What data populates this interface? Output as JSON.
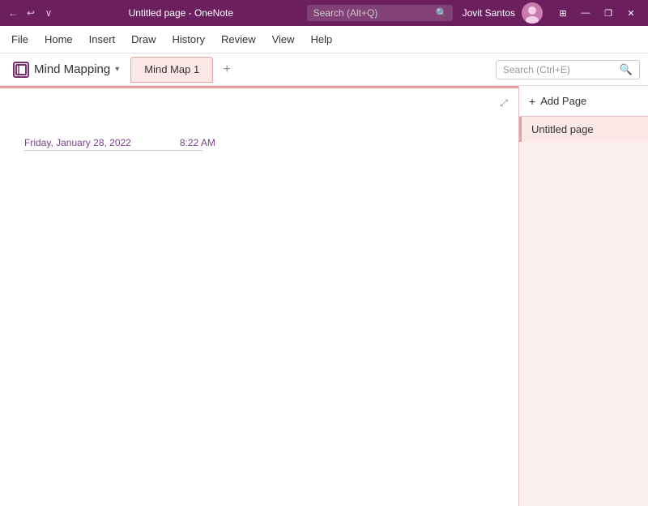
{
  "titlebar": {
    "back_btn": "←",
    "undo_btn": "↩",
    "more_btn": "∨",
    "title": "Untitled page - OneNote",
    "search_placeholder": "Search (Alt+Q)",
    "user_name": "Jovit Santos",
    "restore_icon": "❐",
    "minimize_icon": "—",
    "maximize_icon": "☐",
    "close_icon": "✕",
    "settings_icon": "⊞"
  },
  "menubar": {
    "items": [
      "File",
      "Home",
      "Insert",
      "Draw",
      "History",
      "Review",
      "View",
      "Help"
    ]
  },
  "sectionbar": {
    "notebook_name": "Mind Mapping",
    "tab_label": "Mind Map 1",
    "add_tab_icon": "+",
    "search_placeholder": "Search (Ctrl+E)"
  },
  "page": {
    "date": "Friday, January 28, 2022",
    "time": "8:22 AM",
    "expand_icon": "⤢"
  },
  "sidebar": {
    "add_page_label": "Add Page",
    "add_icon": "+",
    "pages": [
      {
        "title": "Untitled page"
      }
    ]
  }
}
